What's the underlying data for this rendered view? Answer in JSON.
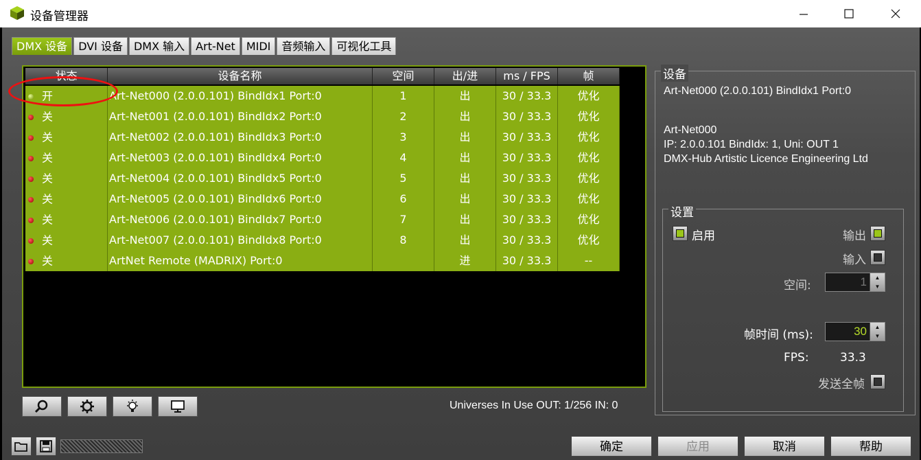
{
  "window": {
    "title": "设备管理器"
  },
  "tabs": [
    {
      "label": "DMX 设备",
      "active": true
    },
    {
      "label": "DVI 设备",
      "active": false
    },
    {
      "label": "DMX 输入",
      "active": false
    },
    {
      "label": "Art-Net",
      "active": false
    },
    {
      "label": "MIDI",
      "active": false
    },
    {
      "label": "音频输入",
      "active": false
    },
    {
      "label": "可视化工具",
      "active": false
    }
  ],
  "table": {
    "columns": [
      "状态",
      "设备名称",
      "空间",
      "出/进",
      "ms / FPS",
      "帧"
    ],
    "rows": [
      {
        "status": "开",
        "on": true,
        "name": "Art-Net000 (2.0.0.101) BindIdx1 Port:0",
        "universe": "1",
        "direction": "出",
        "ms_fps": "30 / 33.3",
        "frame": "优化"
      },
      {
        "status": "关",
        "on": false,
        "name": "Art-Net001 (2.0.0.101) BindIdx2 Port:0",
        "universe": "2",
        "direction": "出",
        "ms_fps": "30 / 33.3",
        "frame": "优化"
      },
      {
        "status": "关",
        "on": false,
        "name": "Art-Net002 (2.0.0.101) BindIdx3 Port:0",
        "universe": "3",
        "direction": "出",
        "ms_fps": "30 / 33.3",
        "frame": "优化"
      },
      {
        "status": "关",
        "on": false,
        "name": "Art-Net003 (2.0.0.101) BindIdx4 Port:0",
        "universe": "4",
        "direction": "出",
        "ms_fps": "30 / 33.3",
        "frame": "优化"
      },
      {
        "status": "关",
        "on": false,
        "name": "Art-Net004 (2.0.0.101) BindIdx5 Port:0",
        "universe": "5",
        "direction": "出",
        "ms_fps": "30 / 33.3",
        "frame": "优化"
      },
      {
        "status": "关",
        "on": false,
        "name": "Art-Net005 (2.0.0.101) BindIdx6 Port:0",
        "universe": "6",
        "direction": "出",
        "ms_fps": "30 / 33.3",
        "frame": "优化"
      },
      {
        "status": "关",
        "on": false,
        "name": "Art-Net006 (2.0.0.101) BindIdx7 Port:0",
        "universe": "7",
        "direction": "出",
        "ms_fps": "30 / 33.3",
        "frame": "优化"
      },
      {
        "status": "关",
        "on": false,
        "name": "Art-Net007 (2.0.0.101) BindIdx8 Port:0",
        "universe": "8",
        "direction": "出",
        "ms_fps": "30 / 33.3",
        "frame": "优化"
      },
      {
        "status": "关",
        "on": false,
        "name": "ArtNet Remote (MADRIX) Port:0",
        "universe": "",
        "direction": "进",
        "ms_fps": "30 / 33.3",
        "frame": "--"
      }
    ]
  },
  "status_bar": {
    "universes": "Universes In Use OUT: 1/256  IN: 0"
  },
  "device_panel": {
    "title": "设备",
    "device_name": "Art-Net000 (2.0.0.101) BindIdx1 Port:0",
    "line1": "Art-Net000",
    "line2": "IP: 2.0.0.101  BindIdx: 1, Uni: OUT 1",
    "line3": "DMX-Hub Artistic Licence Engineering Ltd"
  },
  "settings": {
    "title": "设置",
    "enable_label": "启用",
    "output_label": "输出",
    "input_label": "输入",
    "universe_label": "空间:",
    "universe_value": "1",
    "frame_time_label": "帧时间 (ms):",
    "frame_time_value": "30",
    "fps_label": "FPS:",
    "fps_value": "33.3",
    "send_full_frame_label": "发送全帧"
  },
  "buttons": {
    "ok": "确定",
    "apply": "应用",
    "cancel": "取消",
    "help": "帮助"
  },
  "colors": {
    "accent": "#8aae13",
    "led_off": "#cc0000",
    "led_on": "#d4f060"
  }
}
